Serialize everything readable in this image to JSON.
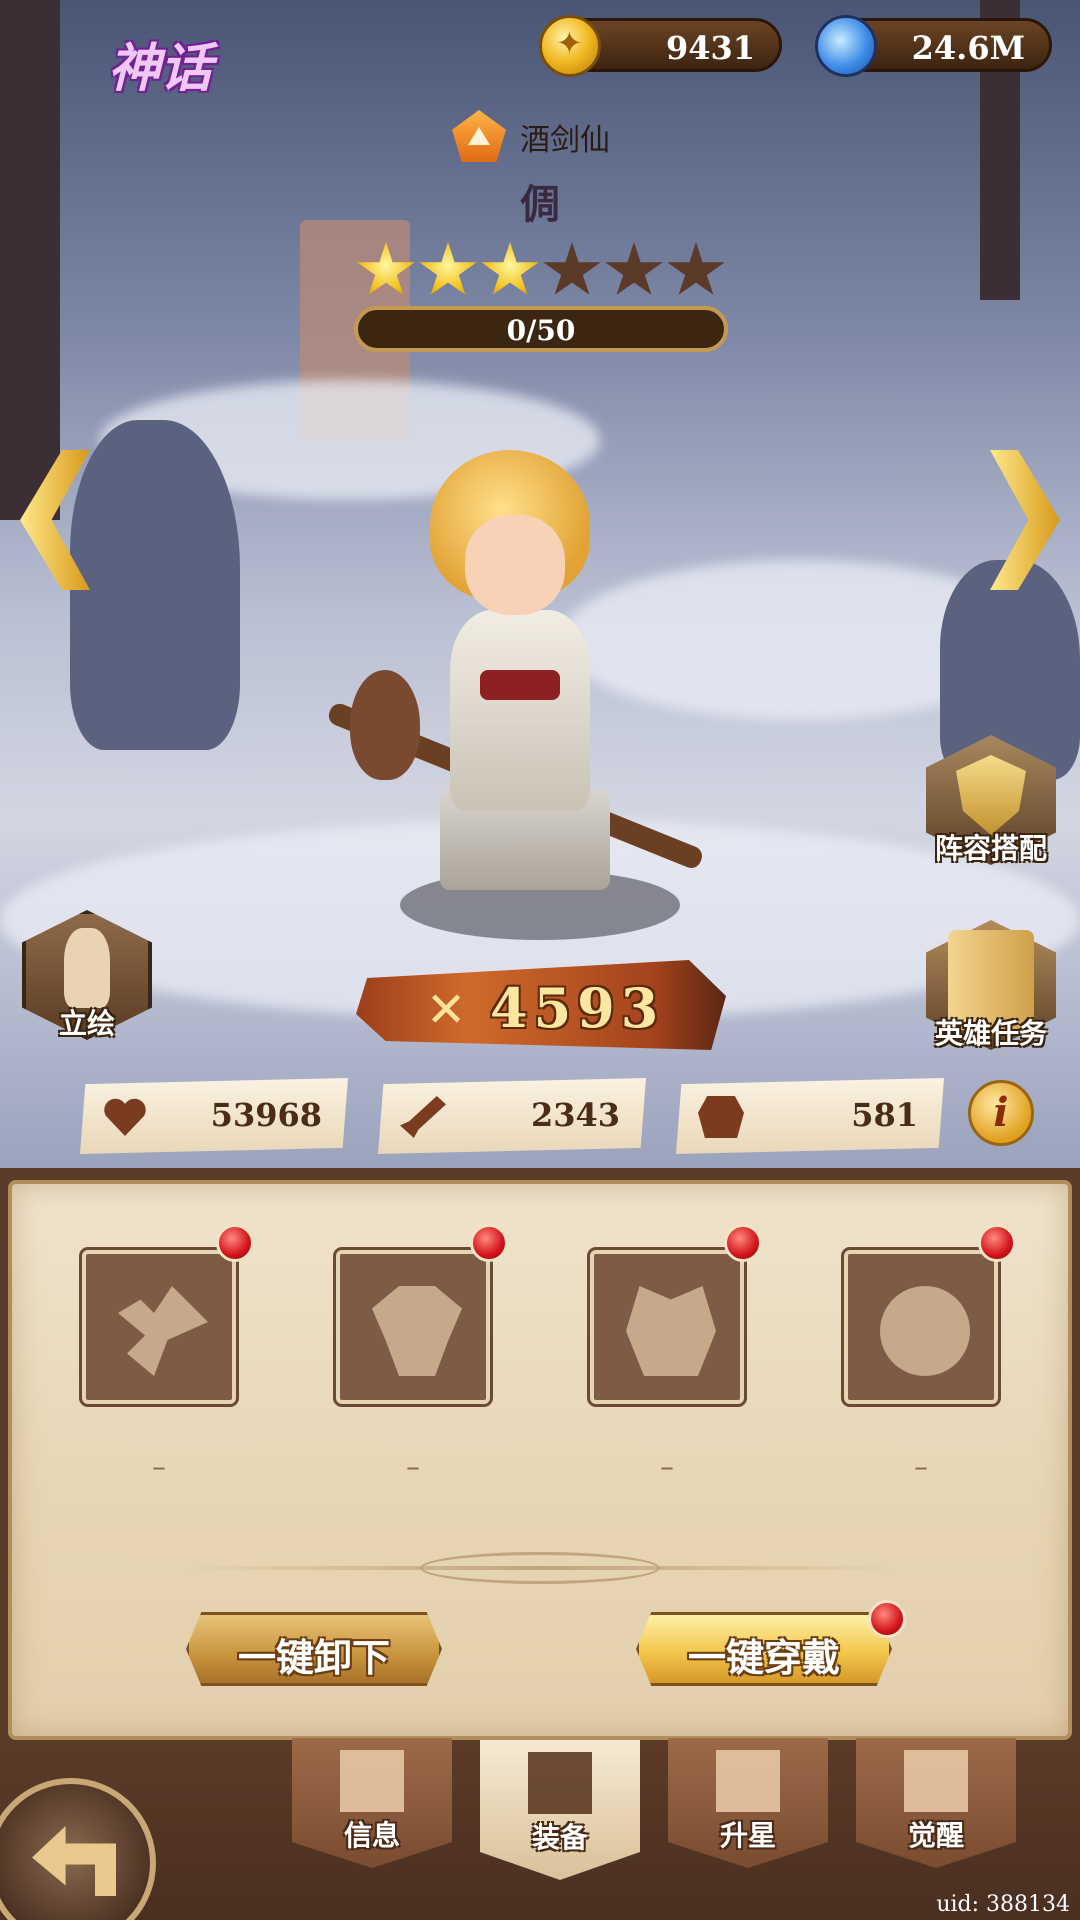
{
  "header": {
    "rarity_label": "神话",
    "gold_amount": "9431",
    "potion_amount": "24.6M"
  },
  "hero": {
    "title": "酒剑仙",
    "name": "倜",
    "stars_filled": 3,
    "stars_total": 6,
    "progress_text": "0/50",
    "progress_fraction": 0,
    "power": "4593"
  },
  "side_buttons": {
    "portrait_label": "立绘",
    "lineup_label": "阵容搭配",
    "quest_label": "英雄任务"
  },
  "stats": {
    "hp": "53968",
    "attack": "2343",
    "defense": "581",
    "info_label": "i"
  },
  "equipment": {
    "slots": [
      {
        "icon": "weapon-icon",
        "empty_label": "–"
      },
      {
        "icon": "armor-icon",
        "empty_label": "–"
      },
      {
        "icon": "helmet-icon",
        "empty_label": "–"
      },
      {
        "icon": "accessory-icon",
        "empty_label": "–"
      }
    ],
    "unequip_all_label": "一键卸下",
    "equip_all_label": "一键穿戴"
  },
  "tabs": [
    {
      "label": "信息",
      "active": false
    },
    {
      "label": "装备",
      "active": true
    },
    {
      "label": "升星",
      "active": false
    },
    {
      "label": "觉醒",
      "active": false
    }
  ],
  "footer": {
    "uid_text": "uid: 388134"
  }
}
